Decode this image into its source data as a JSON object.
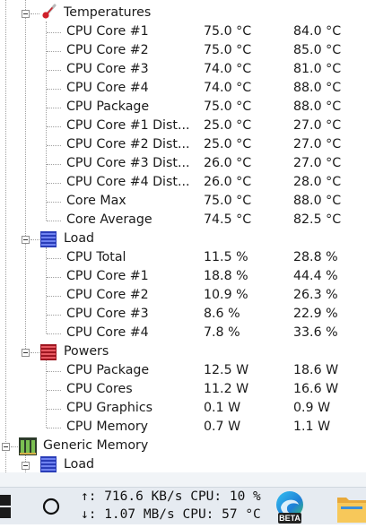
{
  "tree": {
    "temperatures": {
      "label": "Temperatures",
      "rows": [
        {
          "name": "CPU Core #1",
          "value": "75.0 °C",
          "max": "84.0 °C"
        },
        {
          "name": "CPU Core #2",
          "value": "75.0 °C",
          "max": "85.0 °C"
        },
        {
          "name": "CPU Core #3",
          "value": "74.0 °C",
          "max": "81.0 °C"
        },
        {
          "name": "CPU Core #4",
          "value": "74.0 °C",
          "max": "88.0 °C"
        },
        {
          "name": "CPU Package",
          "value": "75.0 °C",
          "max": "88.0 °C"
        },
        {
          "name": "CPU Core #1 Dist...",
          "value": "25.0 °C",
          "max": "27.0 °C"
        },
        {
          "name": "CPU Core #2 Dist...",
          "value": "25.0 °C",
          "max": "27.0 °C"
        },
        {
          "name": "CPU Core #3 Dist...",
          "value": "26.0 °C",
          "max": "27.0 °C"
        },
        {
          "name": "CPU Core #4 Dist...",
          "value": "26.0 °C",
          "max": "28.0 °C"
        },
        {
          "name": "Core Max",
          "value": "75.0 °C",
          "max": "88.0 °C"
        },
        {
          "name": "Core Average",
          "value": "74.5 °C",
          "max": "82.5 °C"
        }
      ]
    },
    "load": {
      "label": "Load",
      "rows": [
        {
          "name": "CPU Total",
          "value": "11.5 %",
          "max": "28.8 %"
        },
        {
          "name": "CPU Core #1",
          "value": "18.8 %",
          "max": "44.4 %"
        },
        {
          "name": "CPU Core #2",
          "value": "10.9 %",
          "max": "26.3 %"
        },
        {
          "name": "CPU Core #3",
          "value": "8.6 %",
          "max": "22.9 %"
        },
        {
          "name": "CPU Core #4",
          "value": "7.8 %",
          "max": "33.6 %"
        }
      ]
    },
    "powers": {
      "label": "Powers",
      "rows": [
        {
          "name": "CPU Package",
          "value": "12.5 W",
          "max": "18.6 W"
        },
        {
          "name": "CPU Cores",
          "value": "11.2 W",
          "max": "16.6 W"
        },
        {
          "name": "CPU Graphics",
          "value": "0.1 W",
          "max": "0.9 W"
        },
        {
          "name": "CPU Memory",
          "value": "0.7 W",
          "max": "1.1 W"
        }
      ]
    },
    "generic_memory": {
      "label": "Generic Memory",
      "child_label": "Load"
    }
  },
  "taskbar": {
    "net_up": "↑:   716.6 KB/s CPU:  10 %",
    "net_down": "↓:    1.07 MB/s CPU:  57 °C",
    "edge_badge": "BETA"
  },
  "colors": {
    "load_icon": "#3c4fd0",
    "powers_icon": "#c0202a",
    "thermometer": "#d0202a",
    "taskbar_bg": "#e6ebf1"
  }
}
